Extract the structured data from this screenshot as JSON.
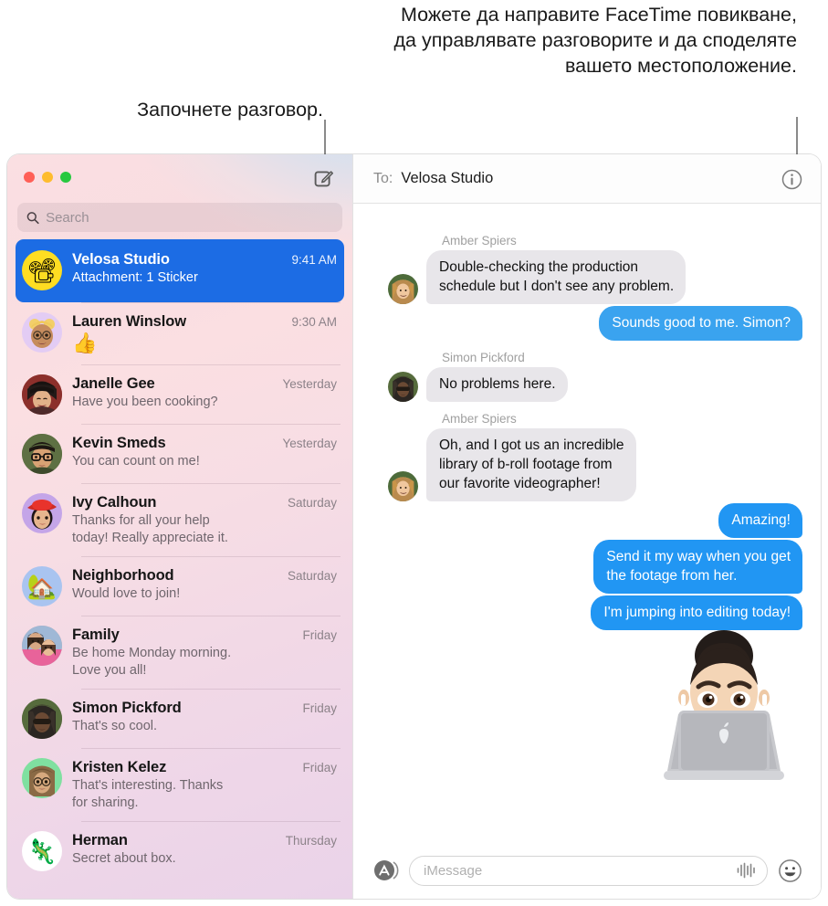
{
  "callouts": {
    "left": "Започнете разговор.",
    "right": "Можете да направите FaceTime повикване, да управлявате разговорите и да споделяте вашето местоположение."
  },
  "sidebar": {
    "search": {
      "placeholder": "Search",
      "value": ""
    },
    "conversations": [
      {
        "title": "Velosa Studio",
        "time": "9:41 AM",
        "preview": "Attachment: 1 Sticker",
        "avatar": {
          "kind": "emoji",
          "glyph": "📽",
          "bg": "#ffdd22"
        },
        "selected": true
      },
      {
        "title": "Lauren Winslow",
        "time": "9:30 AM",
        "preview": "👍",
        "preview_is_emoji": true,
        "avatar": {
          "kind": "memoji-blonde",
          "glyph": "",
          "bg": "#e3ccf4"
        },
        "selected": false
      },
      {
        "title": "Janelle Gee",
        "time": "Yesterday",
        "preview": "Have you been cooking?",
        "avatar": {
          "kind": "photo-janelle",
          "glyph": "",
          "bg": "#8c2f2b"
        },
        "selected": false
      },
      {
        "title": "Kevin Smeds",
        "time": "Yesterday",
        "preview": "You can count on me!",
        "avatar": {
          "kind": "photo-kevin",
          "glyph": "",
          "bg": "#5c6b3f"
        },
        "selected": false
      },
      {
        "title": "Ivy Calhoun",
        "time": "Saturday",
        "preview": "Thanks for all your help\ntoday! Really appreciate it.",
        "avatar": {
          "kind": "memoji-redhat",
          "glyph": "",
          "bg": "#c4a5e8"
        },
        "selected": false
      },
      {
        "title": "Neighborhood",
        "time": "Saturday",
        "preview": "Would love to join!",
        "avatar": {
          "kind": "emoji",
          "glyph": "🏡",
          "bg": "#a9c4f0"
        },
        "selected": false
      },
      {
        "title": "Family",
        "time": "Friday",
        "preview": "Be home Monday morning.\nLove you all!",
        "avatar": {
          "kind": "photo-family",
          "glyph": "",
          "bg": "#d9a088"
        },
        "selected": false
      },
      {
        "title": "Simon Pickford",
        "time": "Friday",
        "preview": "That's so cool.",
        "avatar": {
          "kind": "photo-simon",
          "glyph": "",
          "bg": "#4e5a3a"
        },
        "selected": false
      },
      {
        "title": "Kristen Kelez",
        "time": "Friday",
        "preview": "That's interesting. Thanks\nfor sharing.",
        "avatar": {
          "kind": "memoji-green",
          "glyph": "",
          "bg": "#7fe0a0"
        },
        "selected": false
      },
      {
        "title": "Herman",
        "time": "Thursday",
        "preview": "Secret about box.",
        "avatar": {
          "kind": "emoji",
          "glyph": "🦎",
          "bg": "#ffffff"
        },
        "selected": false
      }
    ]
  },
  "chat": {
    "to_label": "To:",
    "recipient": "Velosa Studio",
    "info_icon": "info-circle-icon",
    "messages": [
      {
        "sender": "Amber Spiers",
        "direction": "in",
        "text": "Double-checking the production\nschedule but I don't see any problem.",
        "avatar": "photo-amber"
      },
      {
        "sender": "",
        "direction": "out",
        "text": "Sounds good to me. Simon?",
        "accent": false
      },
      {
        "sender": "Simon Pickford",
        "direction": "in",
        "text": "No problems here.",
        "avatar": "photo-simon"
      },
      {
        "sender": "Amber Spiers",
        "direction": "in",
        "text": "Oh, and I got us an incredible\nlibrary of b-roll footage from\nour favorite videographer!",
        "avatar": "photo-amber"
      },
      {
        "sender": "",
        "direction": "out",
        "text": "Amazing!",
        "accent": true
      },
      {
        "sender": "",
        "direction": "out",
        "text": "Send it my way when you get\nthe footage from her.",
        "accent": true
      },
      {
        "sender": "",
        "direction": "out",
        "text": "I'm jumping into editing today!",
        "accent": true
      }
    ],
    "sticker": "memoji-laptop-sticker"
  },
  "composer": {
    "apps_icon": "app-store-icon",
    "placeholder": "iMessage",
    "value": "",
    "audio_icon": "audio-waveform-icon",
    "emoji_icon": "emoji-smiley-icon"
  },
  "colors": {
    "selected_row": "#1c6ce4",
    "bubble_out": "#3aa3ef",
    "bubble_out_accent": "#2196f3",
    "bubble_in": "#e8e6ea"
  },
  "window_controls": {
    "close": "close-button",
    "minimize": "minimize-button",
    "zoom": "zoom-button",
    "compose": "compose-button"
  }
}
